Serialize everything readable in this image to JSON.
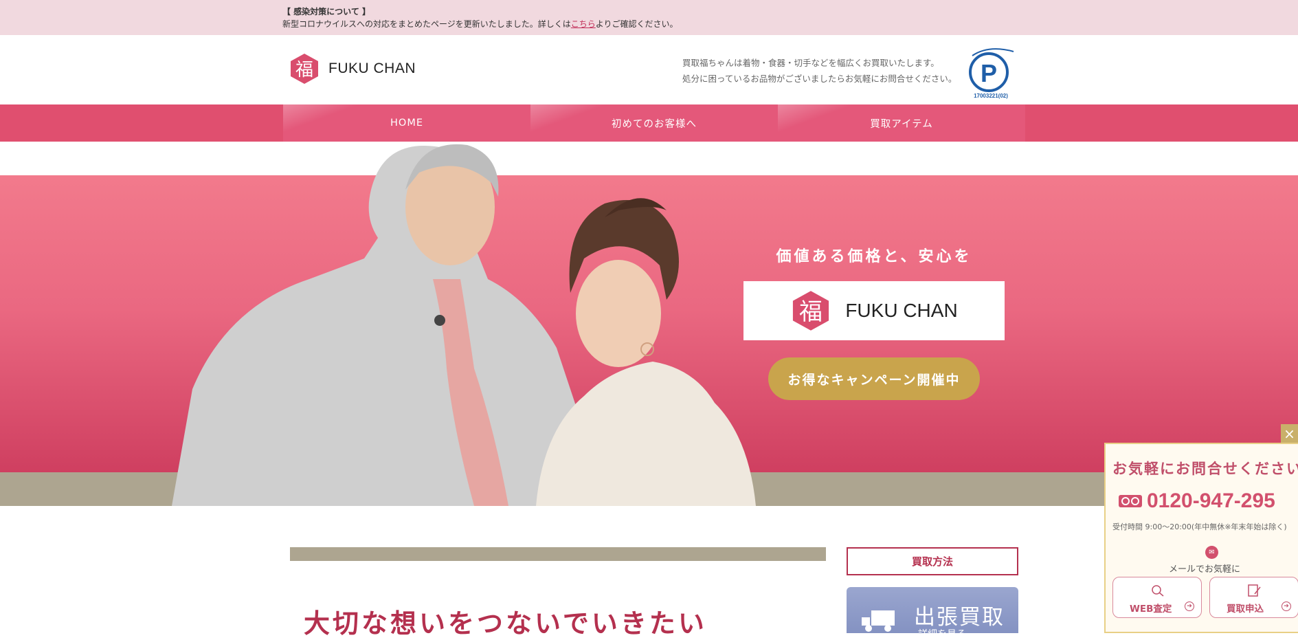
{
  "notice": {
    "title": "【 感染対策について 】",
    "text_before": "新型コロナウイルスへの対応をまとめたページを更新いたしました。詳しくは",
    "link": "こちら",
    "text_after": "よりご確認ください。"
  },
  "header": {
    "logo_name": "FUKU CHAN",
    "logo_mark_char": "福",
    "tagline_1": "買取福ちゃんは着物・食器・切手などを幅広くお買取いたします。",
    "tagline_2": "処分に困っているお品物がございましたらお気軽にお問合せください。",
    "pmark_number": "17003221(02)"
  },
  "nav": {
    "items": [
      "HOME",
      "初めてのお客様へ",
      "買取アイテム"
    ]
  },
  "hero": {
    "copy": "価値ある価格と、安心を",
    "logo_name": "FUKU CHAN",
    "campaign_label": "お得なキャンペーン開催中"
  },
  "content": {
    "heading": "大切な想いをつないでいきたい"
  },
  "sidebar": {
    "title": "買取方法",
    "card_label": "出張買取",
    "card_sub": "詳細を見る"
  },
  "contact_widget": {
    "close_label": "×",
    "title": "お気軽にお問合せください",
    "phone": "0120-947-295",
    "hours": "受付時間 9:00〜20:00(年中無休※年末年始は除く)",
    "mail_text": "メールでお気軽に",
    "web_button": "WEB査定",
    "apply_button": "買取申込"
  },
  "colors": {
    "brand_pink": "#e04f6f",
    "accent_red": "#b4304e",
    "gold": "#c9a44c",
    "taupe": "#ada590"
  }
}
